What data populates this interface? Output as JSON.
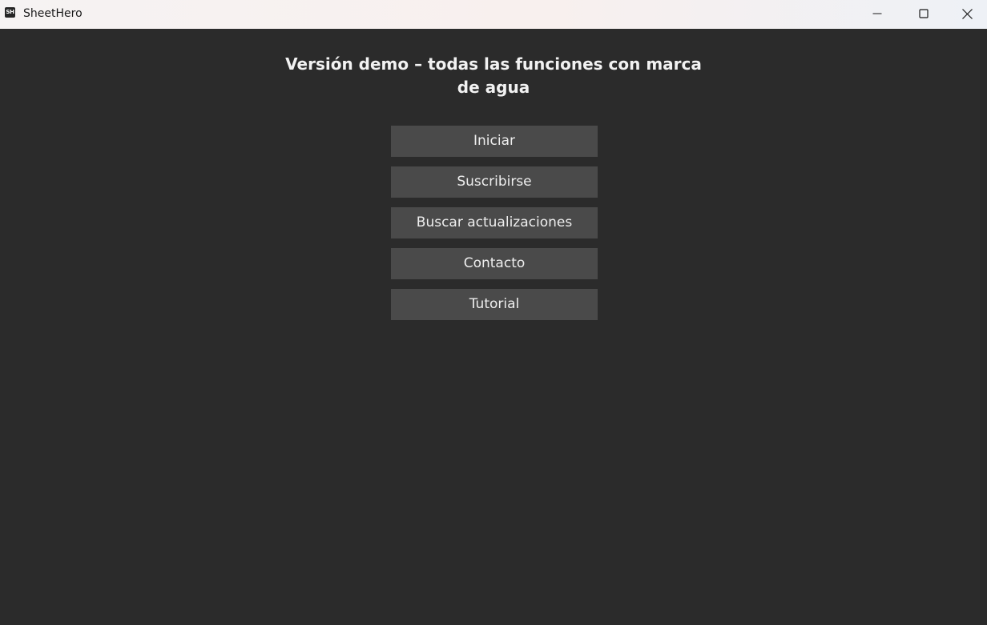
{
  "window": {
    "title": "SheetHero",
    "icon_text": "SH",
    "controls": {
      "minimize": "minimize-icon",
      "maximize": "maximize-icon",
      "close": "close-icon"
    }
  },
  "main": {
    "heading": "Versión demo – todas las funciones con marca de agua",
    "buttons": [
      {
        "label": "Iniciar"
      },
      {
        "label": "Suscribirse"
      },
      {
        "label": "Buscar actualizaciones"
      },
      {
        "label": "Contacto"
      },
      {
        "label": "Tutorial"
      }
    ]
  },
  "colors": {
    "background": "#2b2b2b",
    "button": "#4a4a4a",
    "text": "#f2f2f2"
  }
}
